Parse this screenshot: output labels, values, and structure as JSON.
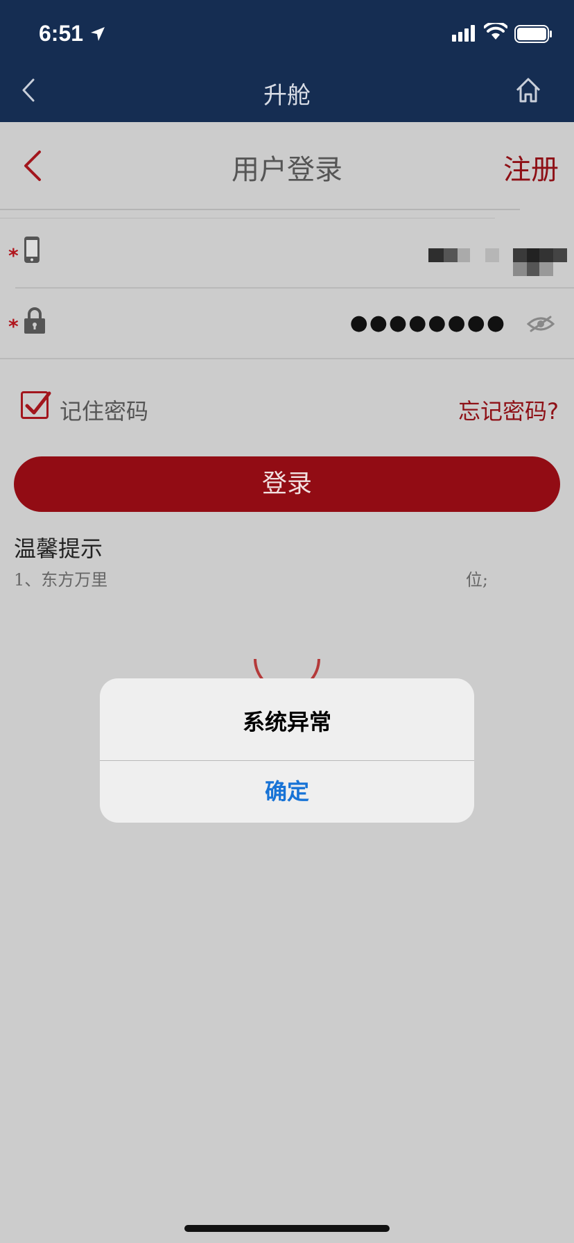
{
  "status_bar": {
    "time": "6:51"
  },
  "nav": {
    "title": "升舱",
    "back_icon": "chevron-left-icon",
    "home_icon": "home-icon"
  },
  "page": {
    "title": "用户登录",
    "register_label": "注册"
  },
  "form": {
    "required_mark": "*",
    "phone_icon": "phone-icon",
    "lock_icon": "lock-icon",
    "password_value": "●●●●●●●●",
    "eye_icon": "eye-slash-icon",
    "remember_label": "记住密码",
    "remember_checked": true,
    "forgot_label": "忘记密码?",
    "login_label": "登录"
  },
  "tips": {
    "title": "温馨提示",
    "line1_left": "1、东方万里",
    "line1_right": "位;"
  },
  "alert": {
    "title": "系统异常",
    "ok_label": "确定"
  },
  "colors": {
    "navbar": "#152d52",
    "accent": "#920c14",
    "alert_button": "#1773d6",
    "background": "#cccccc"
  }
}
